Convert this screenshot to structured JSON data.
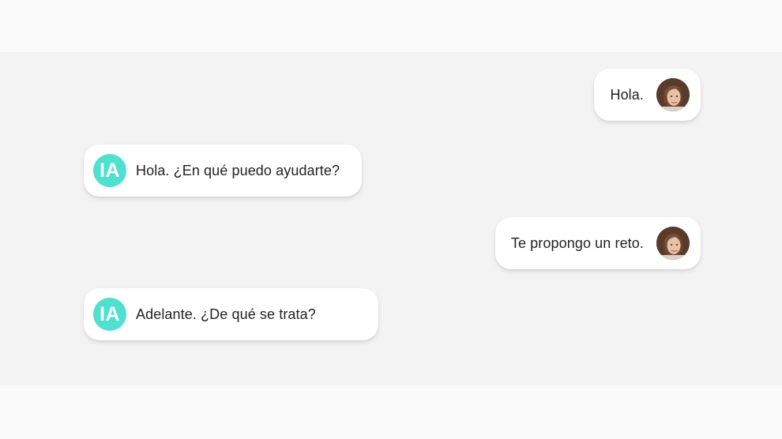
{
  "colors": {
    "ai_avatar": "#4fe0d0",
    "bubble_bg": "#ffffff",
    "chat_bg": "#f3f3f3",
    "text": "#222222"
  },
  "ai_avatar_label": "IA",
  "messages": [
    {
      "sender": "user",
      "text": "Hola.",
      "avatar_icon": "user-photo-icon"
    },
    {
      "sender": "ai",
      "text": "Hola. ¿En qué puedo ayudarte?"
    },
    {
      "sender": "user",
      "text": "Te propongo un reto.",
      "avatar_icon": "user-photo-icon"
    },
    {
      "sender": "ai",
      "text": "Adelante. ¿De qué se trata?"
    }
  ]
}
